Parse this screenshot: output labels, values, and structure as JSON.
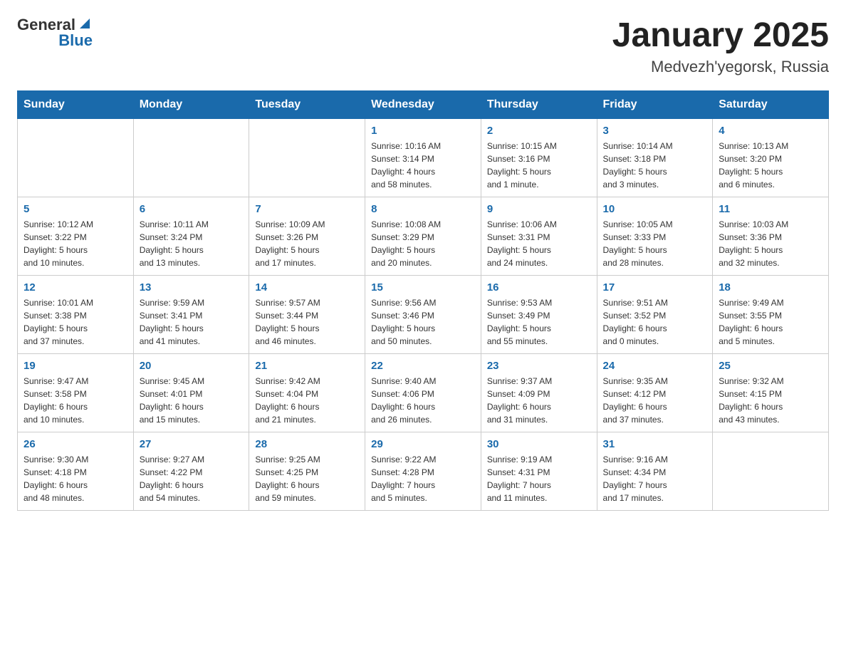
{
  "header": {
    "logo": {
      "general": "General",
      "blue": "Blue"
    },
    "title": "January 2025",
    "location": "Medvezh'yegorsk, Russia"
  },
  "days_of_week": [
    "Sunday",
    "Monday",
    "Tuesday",
    "Wednesday",
    "Thursday",
    "Friday",
    "Saturday"
  ],
  "weeks": [
    [
      {
        "day": "",
        "info": ""
      },
      {
        "day": "",
        "info": ""
      },
      {
        "day": "",
        "info": ""
      },
      {
        "day": "1",
        "info": "Sunrise: 10:16 AM\nSunset: 3:14 PM\nDaylight: 4 hours\nand 58 minutes."
      },
      {
        "day": "2",
        "info": "Sunrise: 10:15 AM\nSunset: 3:16 PM\nDaylight: 5 hours\nand 1 minute."
      },
      {
        "day": "3",
        "info": "Sunrise: 10:14 AM\nSunset: 3:18 PM\nDaylight: 5 hours\nand 3 minutes."
      },
      {
        "day": "4",
        "info": "Sunrise: 10:13 AM\nSunset: 3:20 PM\nDaylight: 5 hours\nand 6 minutes."
      }
    ],
    [
      {
        "day": "5",
        "info": "Sunrise: 10:12 AM\nSunset: 3:22 PM\nDaylight: 5 hours\nand 10 minutes."
      },
      {
        "day": "6",
        "info": "Sunrise: 10:11 AM\nSunset: 3:24 PM\nDaylight: 5 hours\nand 13 minutes."
      },
      {
        "day": "7",
        "info": "Sunrise: 10:09 AM\nSunset: 3:26 PM\nDaylight: 5 hours\nand 17 minutes."
      },
      {
        "day": "8",
        "info": "Sunrise: 10:08 AM\nSunset: 3:29 PM\nDaylight: 5 hours\nand 20 minutes."
      },
      {
        "day": "9",
        "info": "Sunrise: 10:06 AM\nSunset: 3:31 PM\nDaylight: 5 hours\nand 24 minutes."
      },
      {
        "day": "10",
        "info": "Sunrise: 10:05 AM\nSunset: 3:33 PM\nDaylight: 5 hours\nand 28 minutes."
      },
      {
        "day": "11",
        "info": "Sunrise: 10:03 AM\nSunset: 3:36 PM\nDaylight: 5 hours\nand 32 minutes."
      }
    ],
    [
      {
        "day": "12",
        "info": "Sunrise: 10:01 AM\nSunset: 3:38 PM\nDaylight: 5 hours\nand 37 minutes."
      },
      {
        "day": "13",
        "info": "Sunrise: 9:59 AM\nSunset: 3:41 PM\nDaylight: 5 hours\nand 41 minutes."
      },
      {
        "day": "14",
        "info": "Sunrise: 9:57 AM\nSunset: 3:44 PM\nDaylight: 5 hours\nand 46 minutes."
      },
      {
        "day": "15",
        "info": "Sunrise: 9:56 AM\nSunset: 3:46 PM\nDaylight: 5 hours\nand 50 minutes."
      },
      {
        "day": "16",
        "info": "Sunrise: 9:53 AM\nSunset: 3:49 PM\nDaylight: 5 hours\nand 55 minutes."
      },
      {
        "day": "17",
        "info": "Sunrise: 9:51 AM\nSunset: 3:52 PM\nDaylight: 6 hours\nand 0 minutes."
      },
      {
        "day": "18",
        "info": "Sunrise: 9:49 AM\nSunset: 3:55 PM\nDaylight: 6 hours\nand 5 minutes."
      }
    ],
    [
      {
        "day": "19",
        "info": "Sunrise: 9:47 AM\nSunset: 3:58 PM\nDaylight: 6 hours\nand 10 minutes."
      },
      {
        "day": "20",
        "info": "Sunrise: 9:45 AM\nSunset: 4:01 PM\nDaylight: 6 hours\nand 15 minutes."
      },
      {
        "day": "21",
        "info": "Sunrise: 9:42 AM\nSunset: 4:04 PM\nDaylight: 6 hours\nand 21 minutes."
      },
      {
        "day": "22",
        "info": "Sunrise: 9:40 AM\nSunset: 4:06 PM\nDaylight: 6 hours\nand 26 minutes."
      },
      {
        "day": "23",
        "info": "Sunrise: 9:37 AM\nSunset: 4:09 PM\nDaylight: 6 hours\nand 31 minutes."
      },
      {
        "day": "24",
        "info": "Sunrise: 9:35 AM\nSunset: 4:12 PM\nDaylight: 6 hours\nand 37 minutes."
      },
      {
        "day": "25",
        "info": "Sunrise: 9:32 AM\nSunset: 4:15 PM\nDaylight: 6 hours\nand 43 minutes."
      }
    ],
    [
      {
        "day": "26",
        "info": "Sunrise: 9:30 AM\nSunset: 4:18 PM\nDaylight: 6 hours\nand 48 minutes."
      },
      {
        "day": "27",
        "info": "Sunrise: 9:27 AM\nSunset: 4:22 PM\nDaylight: 6 hours\nand 54 minutes."
      },
      {
        "day": "28",
        "info": "Sunrise: 9:25 AM\nSunset: 4:25 PM\nDaylight: 6 hours\nand 59 minutes."
      },
      {
        "day": "29",
        "info": "Sunrise: 9:22 AM\nSunset: 4:28 PM\nDaylight: 7 hours\nand 5 minutes."
      },
      {
        "day": "30",
        "info": "Sunrise: 9:19 AM\nSunset: 4:31 PM\nDaylight: 7 hours\nand 11 minutes."
      },
      {
        "day": "31",
        "info": "Sunrise: 9:16 AM\nSunset: 4:34 PM\nDaylight: 7 hours\nand 17 minutes."
      },
      {
        "day": "",
        "info": ""
      }
    ]
  ]
}
